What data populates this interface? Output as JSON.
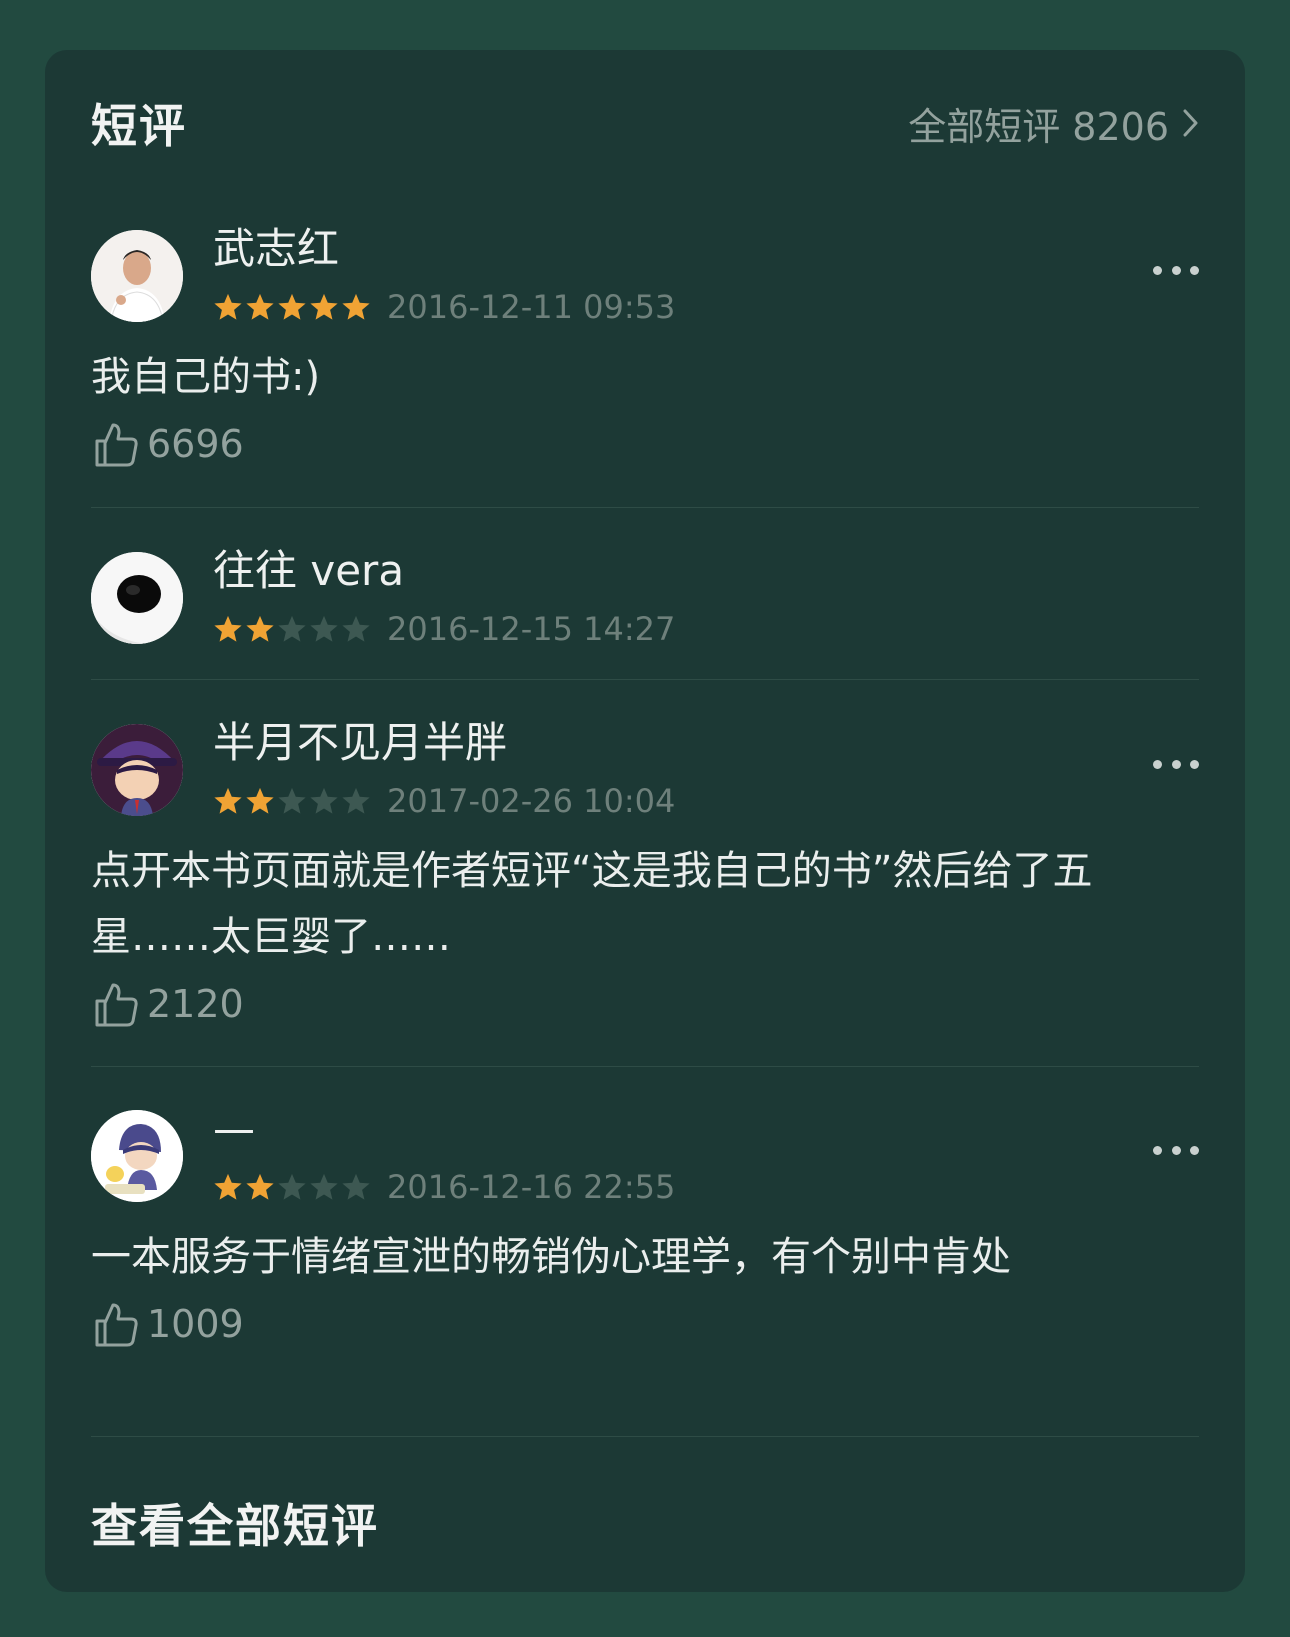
{
  "header": {
    "title": "短评",
    "all_link": "全部短评 8206"
  },
  "reviews": [
    {
      "author": "武志红",
      "stars": 5,
      "date": "2016-12-11 09:53",
      "text": "我自己的书:)",
      "likes": "6696",
      "has_more": true
    },
    {
      "author": "往往 vera",
      "stars": 2,
      "date": "2016-12-15 14:27",
      "text": "",
      "likes": "",
      "has_more": false
    },
    {
      "author": "半月不见月半胖",
      "stars": 2,
      "date": "2017-02-26 10:04",
      "text": "点开本书页面就是作者短评“这是我自己的书”然后给了五星……太巨婴了……",
      "likes": "2120",
      "has_more": true
    },
    {
      "author": "—",
      "stars": 2,
      "date": "2016-12-16 22:55",
      "text": "一本服务于情绪宣泄的畅销伪心理学，有个别中肯处",
      "likes": "1009",
      "has_more": true
    }
  ],
  "footer": {
    "view_all": "查看全部短评"
  },
  "colors": {
    "page_bg": "#224a40",
    "card_bg": "#1c3935",
    "star_on": "#f0a334",
    "star_off": "#3d5852"
  }
}
